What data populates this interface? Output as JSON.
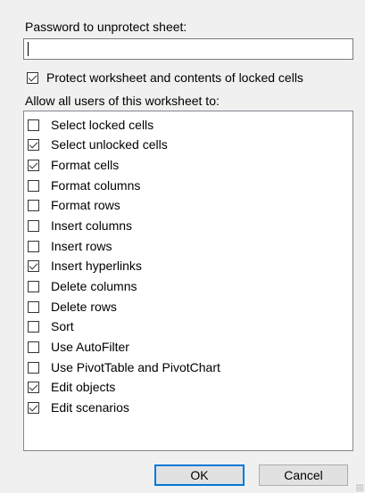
{
  "password": {
    "label": "Password to unprotect sheet:",
    "value": ""
  },
  "protect_option": {
    "label": "Protect worksheet and contents of locked cells",
    "checked": true
  },
  "allow_label": "Allow all users of this worksheet to:",
  "permissions": [
    {
      "label": "Select locked cells",
      "checked": false
    },
    {
      "label": "Select unlocked cells",
      "checked": true
    },
    {
      "label": "Format cells",
      "checked": true
    },
    {
      "label": "Format columns",
      "checked": false
    },
    {
      "label": "Format rows",
      "checked": false
    },
    {
      "label": "Insert columns",
      "checked": false
    },
    {
      "label": "Insert rows",
      "checked": false
    },
    {
      "label": "Insert hyperlinks",
      "checked": true
    },
    {
      "label": "Delete columns",
      "checked": false
    },
    {
      "label": "Delete rows",
      "checked": false
    },
    {
      "label": "Sort",
      "checked": false
    },
    {
      "label": "Use AutoFilter",
      "checked": false
    },
    {
      "label": "Use PivotTable and PivotChart",
      "checked": false
    },
    {
      "label": "Edit objects",
      "checked": true
    },
    {
      "label": "Edit scenarios",
      "checked": true
    }
  ],
  "buttons": {
    "ok_label": "OK",
    "cancel_label": "Cancel"
  }
}
